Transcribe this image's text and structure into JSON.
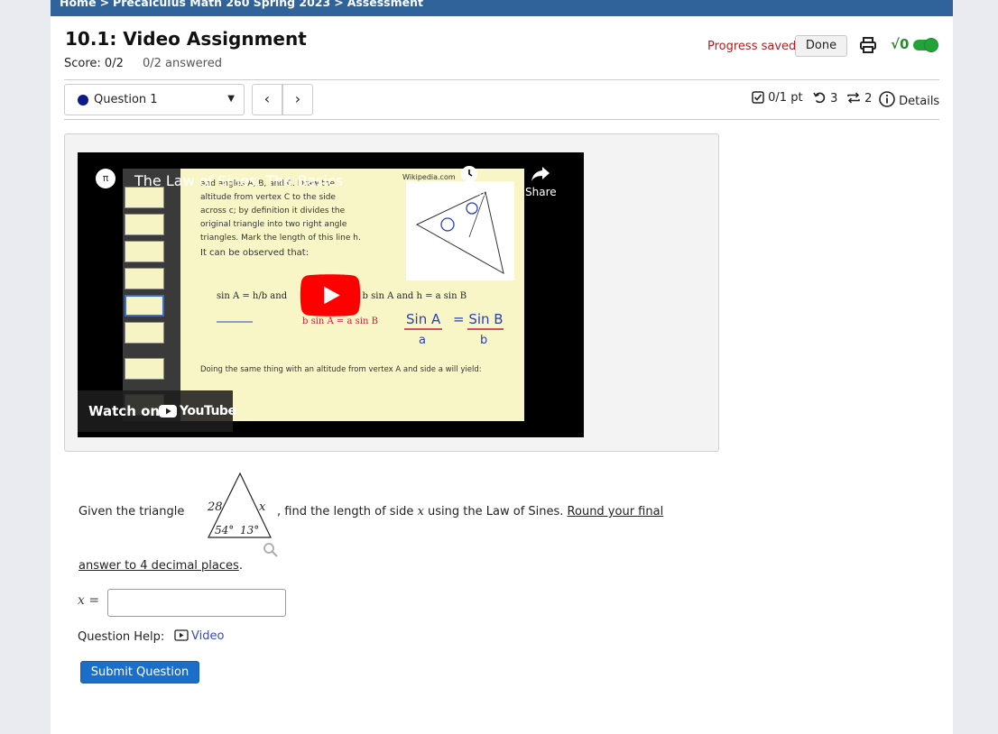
{
  "breadcrumb": {
    "home": "Home",
    "course": "Precalculus Math 260 Spring 2023",
    "page": "Assessment",
    "separator": ">"
  },
  "header": {
    "title": "10.1: Video Assignment",
    "score": "Score: 0/2",
    "answered": "0/2 answered",
    "progress_saved": "Progress saved",
    "done_label": "Done",
    "sqrt_label": "√0"
  },
  "question_nav": {
    "selected": "Question 1",
    "prev_label": "‹",
    "next_label": "›"
  },
  "meta": {
    "points": "0/1 pt",
    "retries": "3",
    "tries": "2",
    "details": "Details"
  },
  "video": {
    "title": "The Law of Sines: The Basics",
    "watch_later": "Watch later",
    "share": "Share",
    "watch_on": "Watch on",
    "youtube": "YouTube",
    "slide_lines": [
      "and angles A, B, and C. Draw the",
      "altitude from vertex C to the side",
      "across c; by definition it divides the",
      "original triangle into two right angle",
      "triangles. Mark the length of this line h.",
      "It can be observed that:"
    ],
    "slide_source": "Wikipedia.com",
    "slide_bottom": "Doing the same thing with an altitude from vertex A and side a will yield:"
  },
  "question": {
    "prefix": "Given the triangle",
    "suffix_plain": ", find the length of side",
    "variable": "x",
    "suffix_after": "using the Law of Sines.",
    "underlined_1": "Round your final",
    "underlined_2": "answer to 4 decimal places",
    "period": ".",
    "triangle": {
      "left_side": "28",
      "right_side": "x",
      "left_angle": "54°",
      "right_angle": "13°"
    },
    "answer_label": "x =",
    "answer_value": ""
  },
  "help": {
    "label": "Question Help:",
    "video_link": "Video"
  },
  "submit_label": "Submit Question",
  "colors": {
    "header_bar": "#2f6399",
    "progress_saved": "#b31b1b",
    "submit": "#1b6fc8",
    "toggle": "#22a33a"
  }
}
